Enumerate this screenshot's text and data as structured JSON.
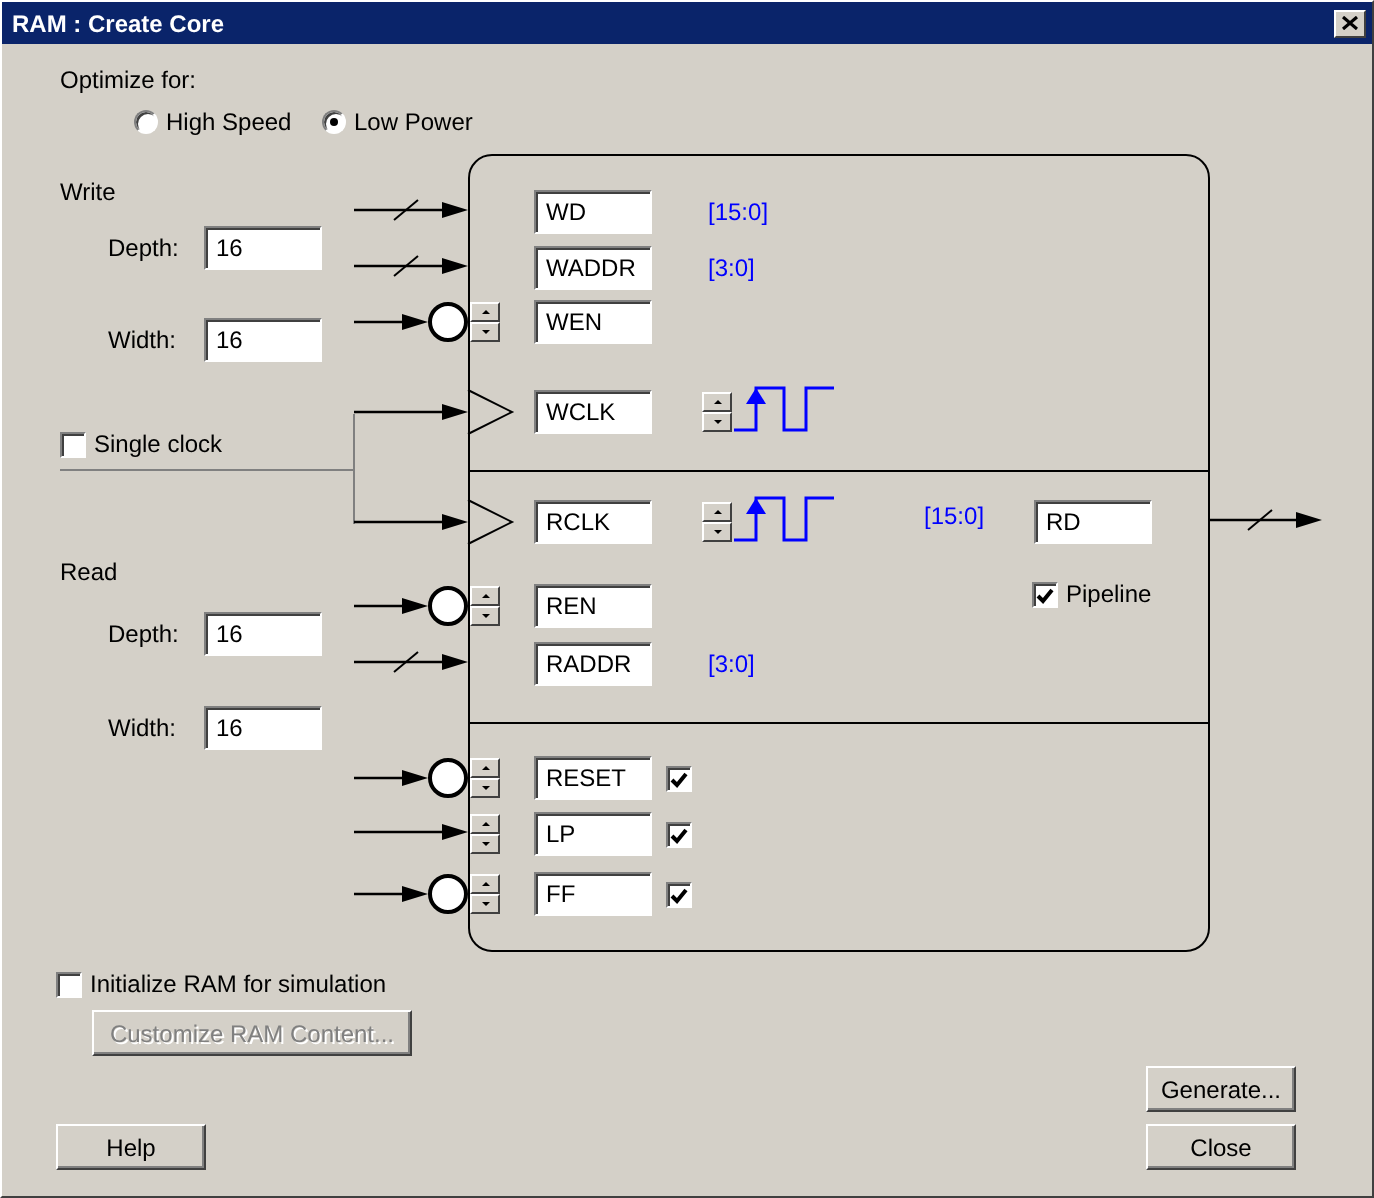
{
  "window": {
    "title": "RAM : Create Core"
  },
  "optimize": {
    "label": "Optimize for:",
    "options": [
      {
        "label": "High Speed",
        "selected": false
      },
      {
        "label": "Low Power",
        "selected": true
      }
    ]
  },
  "write": {
    "heading": "Write",
    "depth": {
      "label": "Depth:",
      "value": "16"
    },
    "width": {
      "label": "Width:",
      "value": "16"
    }
  },
  "single_clock": {
    "label": "Single clock",
    "checked": false
  },
  "read": {
    "heading": "Read",
    "depth": {
      "label": "Depth:",
      "value": "16"
    },
    "width": {
      "label": "Width:",
      "value": "16"
    }
  },
  "ports": [
    {
      "name": "WD",
      "kind": "bus",
      "range": "[15:0]"
    },
    {
      "name": "WADDR",
      "kind": "bus",
      "range": "[3:0]"
    },
    {
      "name": "WEN",
      "kind": "inverted"
    },
    {
      "name": "WCLK",
      "kind": "clock"
    },
    {
      "name": "RCLK",
      "kind": "clock"
    },
    {
      "name": "REN",
      "kind": "inverted"
    },
    {
      "name": "RADDR",
      "kind": "bus",
      "range": "[3:0]"
    },
    {
      "name": "RESET",
      "kind": "inverted",
      "checked": true
    },
    {
      "name": "LP",
      "kind": "plain",
      "checked": true
    },
    {
      "name": "FF",
      "kind": "inverted",
      "checked": true
    }
  ],
  "output": {
    "range": "[15:0]",
    "name": "RD",
    "pipeline": {
      "label": "Pipeline",
      "checked": true
    }
  },
  "initialize": {
    "label": "Initialize RAM for simulation",
    "checked": false
  },
  "customize_button": {
    "label": "Customize RAM Content...",
    "disabled": true
  },
  "buttons": [
    "Generate...",
    "Help",
    "Close"
  ]
}
